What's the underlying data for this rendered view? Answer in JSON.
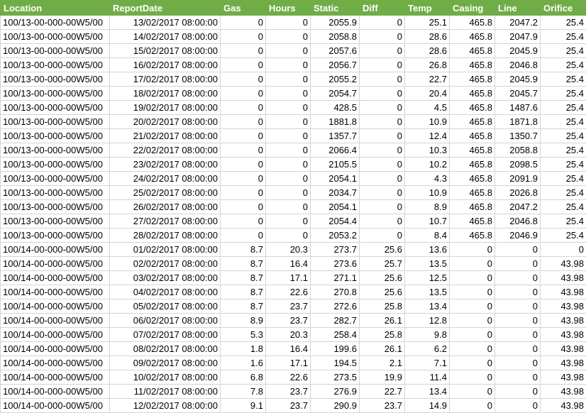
{
  "columns": [
    "Location",
    "ReportDate",
    "Gas",
    "Hours",
    "Static",
    "Diff",
    "Temp",
    "Casing",
    "Line",
    "Orifice"
  ],
  "rows": [
    [
      "100/13-00-000-00W5/00",
      "13/02/2017 08:00:00",
      "0",
      "0",
      "2055.9",
      "0",
      "25.1",
      "465.8",
      "2047.2",
      "25.4"
    ],
    [
      "100/13-00-000-00W5/00",
      "14/02/2017 08:00:00",
      "0",
      "0",
      "2058.8",
      "0",
      "28.6",
      "465.8",
      "2047.9",
      "25.4"
    ],
    [
      "100/13-00-000-00W5/00",
      "15/02/2017 08:00:00",
      "0",
      "0",
      "2057.6",
      "0",
      "28.6",
      "465.8",
      "2045.9",
      "25.4"
    ],
    [
      "100/13-00-000-00W5/00",
      "16/02/2017 08:00:00",
      "0",
      "0",
      "2056.7",
      "0",
      "26.8",
      "465.8",
      "2046.8",
      "25.4"
    ],
    [
      "100/13-00-000-00W5/00",
      "17/02/2017 08:00:00",
      "0",
      "0",
      "2055.2",
      "0",
      "22.7",
      "465.8",
      "2045.9",
      "25.4"
    ],
    [
      "100/13-00-000-00W5/00",
      "18/02/2017 08:00:00",
      "0",
      "0",
      "2054.7",
      "0",
      "20.4",
      "465.8",
      "2045.7",
      "25.4"
    ],
    [
      "100/13-00-000-00W5/00",
      "19/02/2017 08:00:00",
      "0",
      "0",
      "428.5",
      "0",
      "4.5",
      "465.8",
      "1487.6",
      "25.4"
    ],
    [
      "100/13-00-000-00W5/00",
      "20/02/2017 08:00:00",
      "0",
      "0",
      "1881.8",
      "0",
      "10.9",
      "465.8",
      "1871.8",
      "25.4"
    ],
    [
      "100/13-00-000-00W5/00",
      "21/02/2017 08:00:00",
      "0",
      "0",
      "1357.7",
      "0",
      "12.4",
      "465.8",
      "1350.7",
      "25.4"
    ],
    [
      "100/13-00-000-00W5/00",
      "22/02/2017 08:00:00",
      "0",
      "0",
      "2066.4",
      "0",
      "10.3",
      "465.8",
      "2058.8",
      "25.4"
    ],
    [
      "100/13-00-000-00W5/00",
      "23/02/2017 08:00:00",
      "0",
      "0",
      "2105.5",
      "0",
      "10.2",
      "465.8",
      "2098.5",
      "25.4"
    ],
    [
      "100/13-00-000-00W5/00",
      "24/02/2017 08:00:00",
      "0",
      "0",
      "2054.1",
      "0",
      "4.3",
      "465.8",
      "2091.9",
      "25.4"
    ],
    [
      "100/13-00-000-00W5/00",
      "25/02/2017 08:00:00",
      "0",
      "0",
      "2034.7",
      "0",
      "10.9",
      "465.8",
      "2026.8",
      "25.4"
    ],
    [
      "100/13-00-000-00W5/00",
      "26/02/2017 08:00:00",
      "0",
      "0",
      "2054.1",
      "0",
      "8.9",
      "465.8",
      "2047.2",
      "25.4"
    ],
    [
      "100/13-00-000-00W5/00",
      "27/02/2017 08:00:00",
      "0",
      "0",
      "2054.4",
      "0",
      "10.7",
      "465.8",
      "2046.8",
      "25.4"
    ],
    [
      "100/13-00-000-00W5/00",
      "28/02/2017 08:00:00",
      "0",
      "0",
      "2053.2",
      "0",
      "8.4",
      "465.8",
      "2046.9",
      "25.4"
    ],
    [
      "100/14-00-000-00W5/00",
      "01/02/2017 08:00:00",
      "8.7",
      "20.3",
      "273.7",
      "25.6",
      "13.6",
      "0",
      "0",
      "0"
    ],
    [
      "100/14-00-000-00W5/00",
      "02/02/2017 08:00:00",
      "8.7",
      "16.4",
      "273.6",
      "25.7",
      "13.5",
      "0",
      "0",
      "43.98"
    ],
    [
      "100/14-00-000-00W5/00",
      "03/02/2017 08:00:00",
      "8.7",
      "17.1",
      "271.1",
      "25.6",
      "12.5",
      "0",
      "0",
      "43.98"
    ],
    [
      "100/14-00-000-00W5/00",
      "04/02/2017 08:00:00",
      "8.7",
      "22.6",
      "270.8",
      "25.6",
      "13.5",
      "0",
      "0",
      "43.98"
    ],
    [
      "100/14-00-000-00W5/00",
      "05/02/2017 08:00:00",
      "8.7",
      "23.7",
      "272.6",
      "25.8",
      "13.4",
      "0",
      "0",
      "43.98"
    ],
    [
      "100/14-00-000-00W5/00",
      "06/02/2017 08:00:00",
      "8.9",
      "23.7",
      "282.7",
      "26.1",
      "12.8",
      "0",
      "0",
      "43.98"
    ],
    [
      "100/14-00-000-00W5/00",
      "07/02/2017 08:00:00",
      "5.3",
      "20.3",
      "258.4",
      "25.8",
      "9.8",
      "0",
      "0",
      "43.98"
    ],
    [
      "100/14-00-000-00W5/00",
      "08/02/2017 08:00:00",
      "1.8",
      "16.4",
      "199.6",
      "26.1",
      "6.2",
      "0",
      "0",
      "43.98"
    ],
    [
      "100/14-00-000-00W5/00",
      "09/02/2017 08:00:00",
      "1.6",
      "17.1",
      "194.5",
      "2.1",
      "7.1",
      "0",
      "0",
      "43.98"
    ],
    [
      "100/14-00-000-00W5/00",
      "10/02/2017 08:00:00",
      "6.8",
      "22.6",
      "273.5",
      "19.9",
      "11.4",
      "0",
      "0",
      "43.98"
    ],
    [
      "100/14-00-000-00W5/00",
      "11/02/2017 08:00:00",
      "7.8",
      "23.7",
      "276.9",
      "22.7",
      "13.4",
      "0",
      "0",
      "43.98"
    ],
    [
      "100/14-00-000-00W5/00",
      "12/02/2017 08:00:00",
      "9.1",
      "23.7",
      "290.9",
      "23.7",
      "14.9",
      "0",
      "0",
      "43.98"
    ]
  ],
  "colors": {
    "header_bg": "#70ad47",
    "header_text": "#ffffff",
    "grid_line": "#d4d4d4"
  }
}
